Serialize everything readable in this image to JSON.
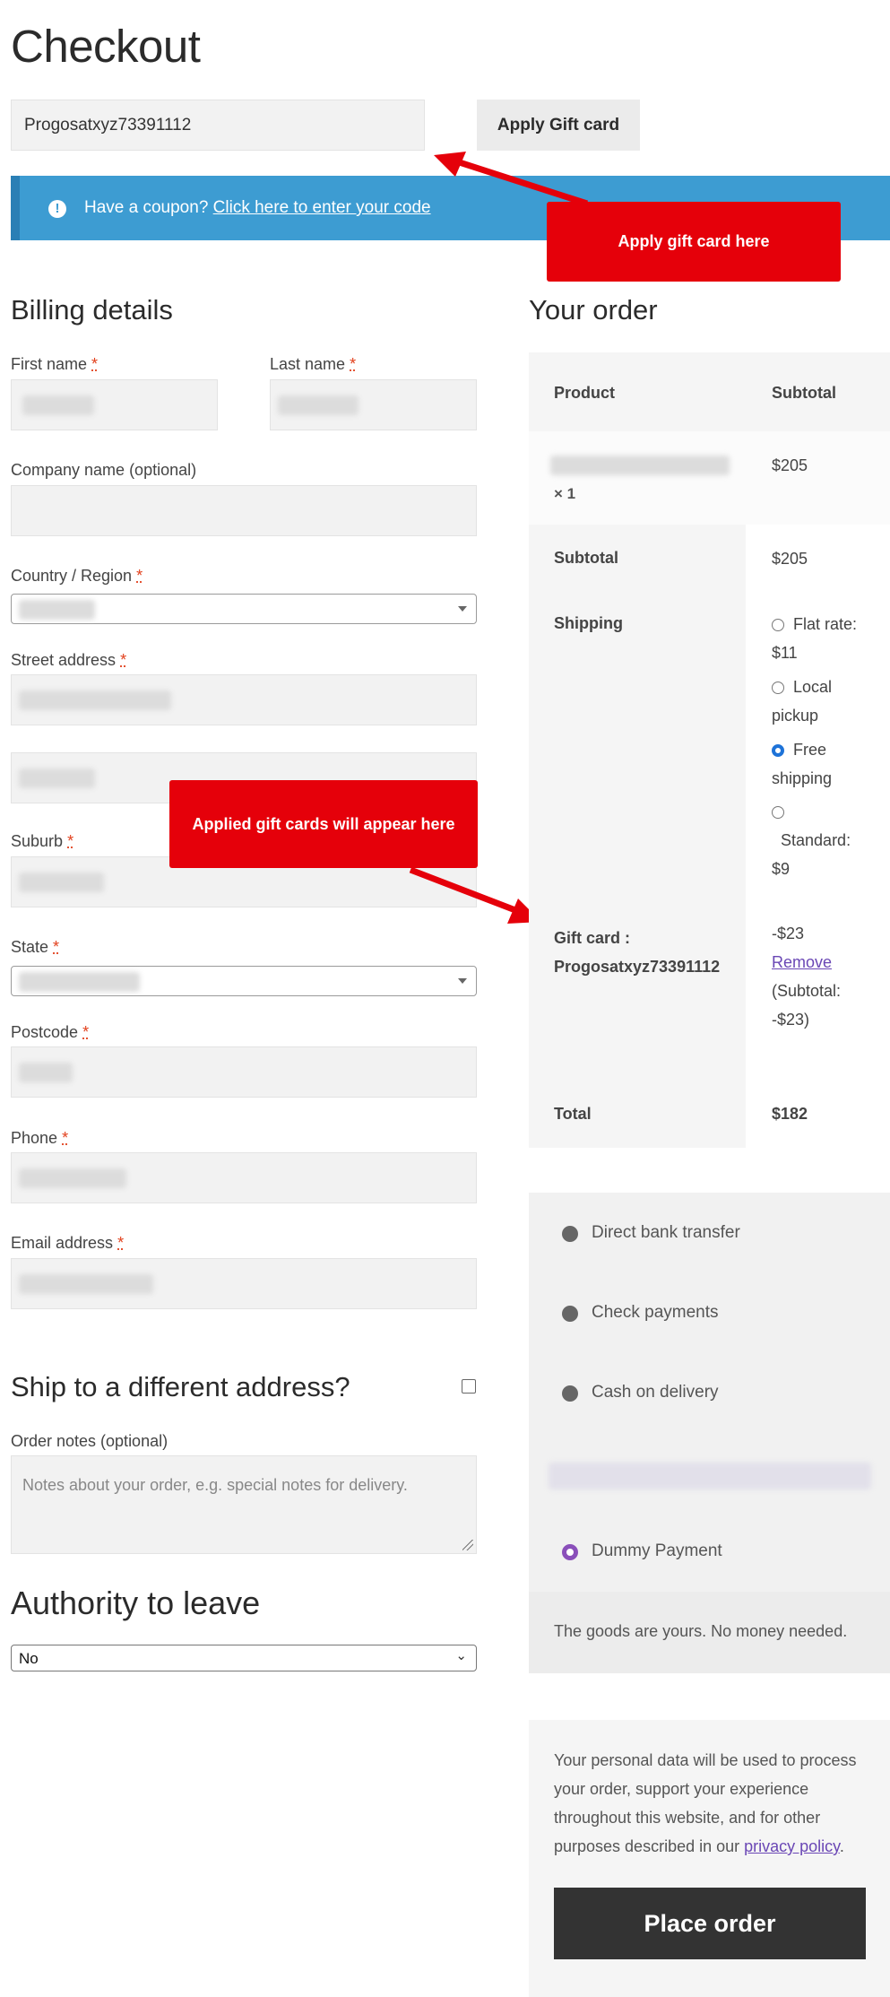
{
  "page": {
    "title": "Checkout"
  },
  "gift_card": {
    "value": "Progosatxyz73391112",
    "apply_label": "Apply Gift card"
  },
  "coupon": {
    "prefix": "Have a coupon?",
    "link": "Click here to enter your code"
  },
  "callouts": {
    "apply": "Apply gift card here",
    "applied": "Applied gift cards will appear here"
  },
  "billing": {
    "heading": "Billing details",
    "first_name": "First name",
    "last_name": "Last name",
    "company": "Company name (optional)",
    "country": "Country / Region",
    "street": "Street address",
    "suburb": "Suburb",
    "state": "State",
    "postcode": "Postcode",
    "phone": "Phone",
    "email": "Email address",
    "required_mark": "*"
  },
  "ship_different": {
    "label": "Ship to a different address?"
  },
  "order_notes": {
    "label": "Order notes (optional)",
    "placeholder": "Notes about your order, e.g. special notes for delivery."
  },
  "authority": {
    "heading": "Authority to leave",
    "selected": "No"
  },
  "order": {
    "heading": "Your order",
    "col_product": "Product",
    "col_subtotal": "Subtotal",
    "item_qty": "× 1",
    "item_price": "$205",
    "subtotal_label": "Subtotal",
    "subtotal_value": "$205",
    "shipping_label": "Shipping",
    "shipping_options": [
      {
        "label": "Flat rate:",
        "price": "$11",
        "selected": false
      },
      {
        "label": "Local",
        "price": "pickup",
        "selected": false
      },
      {
        "label": "Free",
        "price": "shipping",
        "selected": true
      },
      {
        "label": "Standard:",
        "price": "$9",
        "selected": false
      }
    ],
    "gift_label": "Gift card :",
    "gift_code": "Progosatxyz73391112",
    "gift_value": "-$23",
    "gift_remove": "Remove",
    "gift_sub1": "(Subtotal:",
    "gift_sub2": "-$23)",
    "total_label": "Total",
    "total_value": "$182"
  },
  "payment": {
    "methods": [
      "Direct bank transfer",
      "Check payments",
      "Cash on delivery",
      "Dummy Payment"
    ],
    "selected": "Dummy Payment",
    "note": "The goods are yours. No money needed."
  },
  "privacy": {
    "line1": "Your personal data will be used to process",
    "line2": "your order, support your experience",
    "line3": "throughout this website, and for other",
    "line4": "purposes described in our",
    "link": "privacy policy",
    "end": "."
  },
  "place_order": {
    "label": "Place order"
  },
  "colors": {
    "accent_blue": "#3d9cd2",
    "callout_red": "#e5000a",
    "purple": "#8a4fba",
    "button_dark": "#333333"
  }
}
